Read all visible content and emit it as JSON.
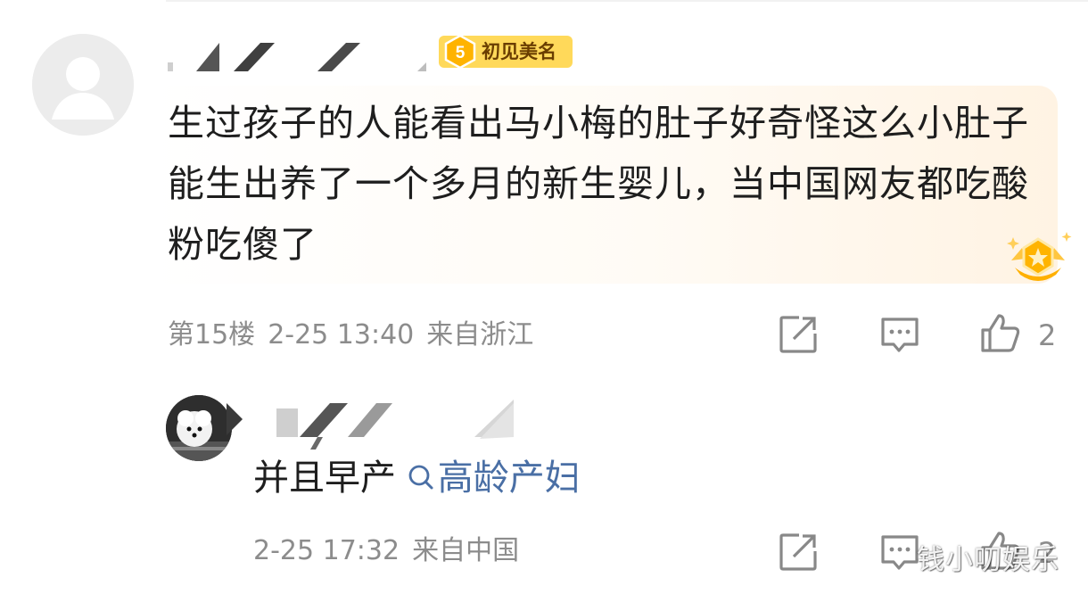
{
  "comment_1": {
    "user_badge": {
      "level": "5",
      "label": "初见美名"
    },
    "text": "生过孩子的人能看出马小梅的肚子好奇怪这么小肚子能生出养了一个多月的新生婴儿，当中国网友都吃酸粉吃傻了",
    "floor": "第15楼",
    "time": "2-25 13:40",
    "location": "来自浙江",
    "like_count": "2"
  },
  "reply_1": {
    "text": "并且早产",
    "search_link": "高龄产妇",
    "time": "2-25 17:32",
    "location": "来自中国",
    "like_count": "2"
  },
  "watermark": "钱小叨娱乐",
  "colors": {
    "meta_gray": "#8c8c8c",
    "badge_yellow": "#ffd95a",
    "link_blue": "#4a6fa5",
    "bubble_tint": "#fff3e3"
  },
  "icons": [
    "default-avatar-icon",
    "level-badge-icon",
    "crown-medal-icon",
    "share-icon",
    "comment-icon",
    "like-icon",
    "search-icon"
  ]
}
